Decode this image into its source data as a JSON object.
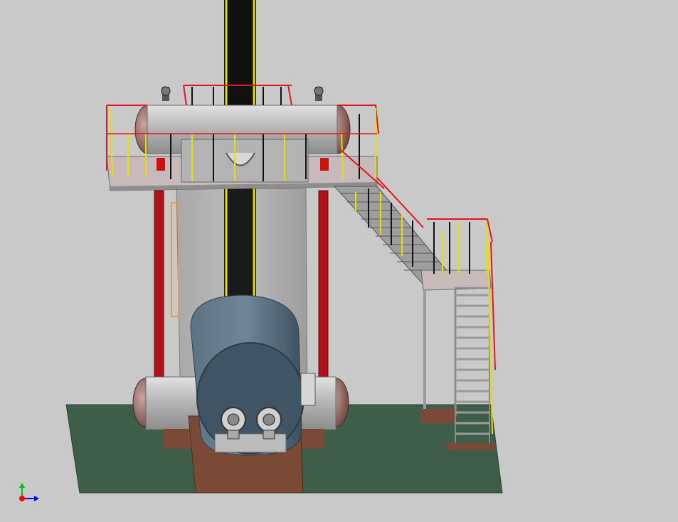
{
  "viewport": {
    "background": "#c9c9c9",
    "description_free": true
  },
  "colors": {
    "ground": "#3f5e4a",
    "foundation": "#7a4a36",
    "column_red": "#b0101a",
    "rail_red": "#e8141e",
    "rail_yellow": "#e6e000",
    "tank_blue": "#4e6475",
    "steel_gray": "#9a9a9a",
    "chimney_black": "#111111",
    "axis_x": "#0000ff",
    "axis_y": "#00c000",
    "axis_origin": "#ff0000"
  },
  "axis_triad": {
    "icon": "coordinate-axis-icon"
  }
}
